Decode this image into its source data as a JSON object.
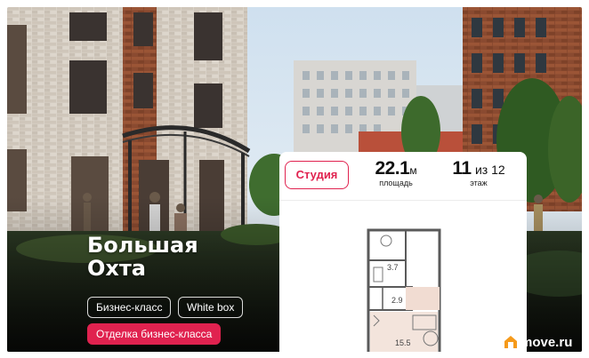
{
  "project": {
    "name_line1": "Большая",
    "name_line2": "Охта"
  },
  "tags": {
    "class_label": "Бизнес-класс",
    "finish_label": "White box",
    "decoration_label": "Отделка бизнес-класса"
  },
  "apartment": {
    "type_label": "Студия",
    "area_value": "22.1",
    "area_unit": "м",
    "area_label": "площадь",
    "floor_value": "11",
    "floor_of": "из 12",
    "floor_label": "этаж"
  },
  "floor_plan": {
    "rooms": [
      {
        "label": "3.7"
      },
      {
        "label": "2.9"
      },
      {
        "label": "15.5"
      }
    ]
  },
  "brand": {
    "text": "move.ru",
    "logo_icon": "house-logo-icon"
  },
  "colors": {
    "accent": "#e0224f",
    "card_bg": "#ffffff",
    "text_dark": "#111111"
  }
}
